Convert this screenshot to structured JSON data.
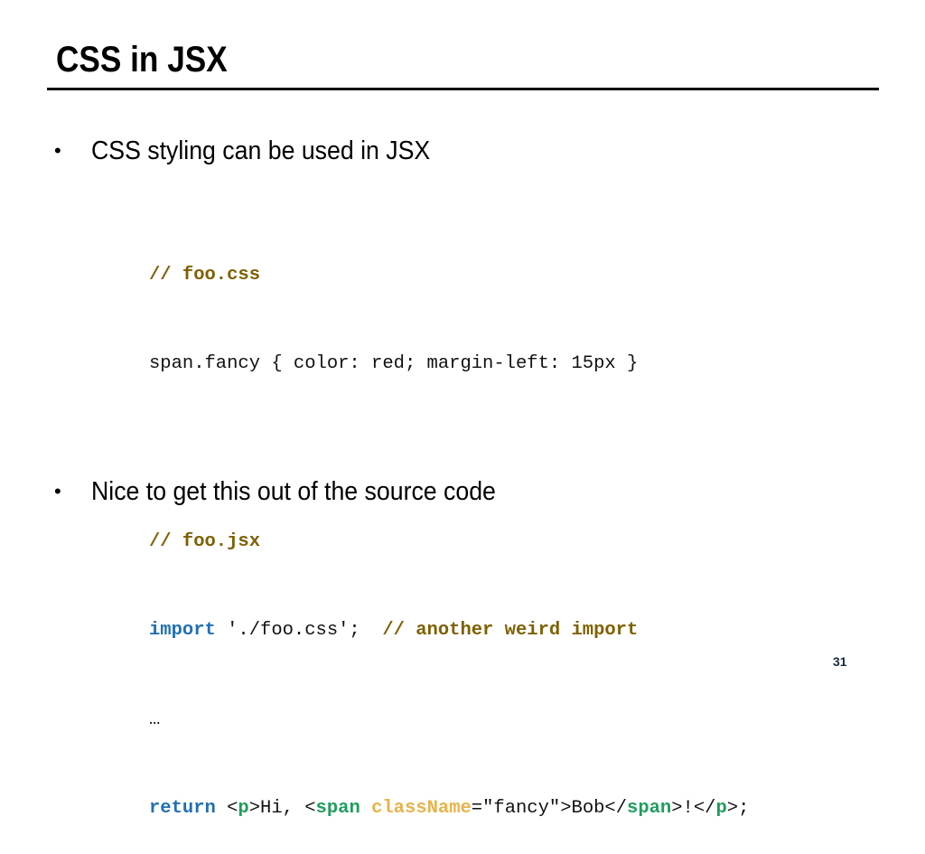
{
  "slide": {
    "title": "CSS in JSX",
    "page_number": "31"
  },
  "bullets": [
    {
      "marker": "•",
      "text": "CSS styling can be used in JSX"
    },
    {
      "marker": "•",
      "text": "Nice to get this out of the source code"
    }
  ],
  "code": {
    "line1_comment": "// foo.css",
    "line2": "span.fancy { color: red; margin-left: 15px }",
    "line4_comment": "// foo.jsx",
    "line5_keyword": "import",
    "line5_text": " './foo.css';  ",
    "line5_comment": "// another weird import",
    "line6": "…",
    "line7": {
      "keyword": "return",
      "t1": " <",
      "tag_p_open": "p",
      "t2": ">Hi, <",
      "tag_span_open": "span",
      "t3": " ",
      "attr": "className",
      "t4": "=\"fancy\">Bob</",
      "tag_span_close": "span",
      "t5": ">!</",
      "tag_p_close": "p",
      "t6": ">;"
    }
  },
  "colors": {
    "comment": "#7f6000",
    "keyword": "#1f6fb5",
    "jsx_tag": "#1e9e5c",
    "jsx_attr": "#e8b34a",
    "text": "#111111"
  }
}
